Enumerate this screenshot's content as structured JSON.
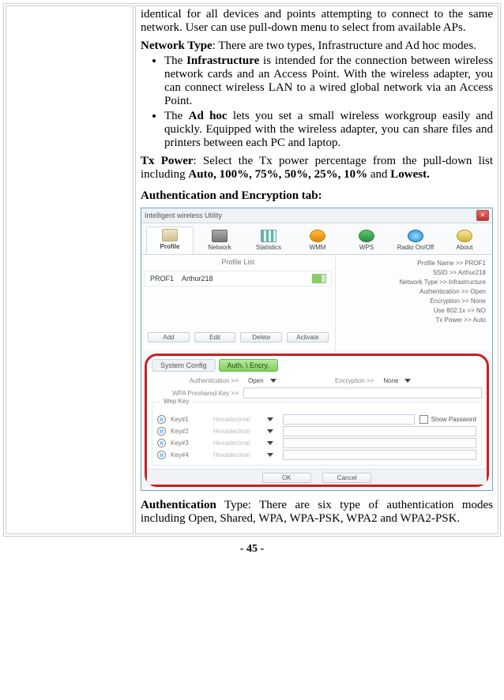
{
  "doc": {
    "intro_para": "identical for all devices and points attempting to connect to the same network. User can use pull-down menu to select from available APs.",
    "network_type_lead": "Network Type",
    "network_type_rest": ": There are two types, Infrastructure and Ad hoc modes.",
    "bullet_infra_pre": "The ",
    "bullet_infra_bold": "Infrastructure",
    "bullet_infra_post": " is intended for the connection between wireless network cards and an Access Point. With the wireless adapter, you can connect wireless LAN to a wired global network via an Access Point.",
    "bullet_adhoc_pre": "The ",
    "bullet_adhoc_bold": "Ad hoc",
    "bullet_adhoc_post": " lets you set a small wireless workgroup easily and quickly. Equipped with the wireless adapter, you can share files and printers between each PC and laptop.",
    "tx_power_lead": "Tx Power",
    "tx_power_mid": ": Select the Tx power percentage from the pull-down list including ",
    "tx_power_opts": "Auto, 100%, 75%, 50%, 25%, 10%",
    "tx_power_and": " and ",
    "tx_power_last": "Lowest.",
    "auth_heading": "Authentication and Encryption tab:",
    "auth_desc_lead": "Authentication",
    "auth_desc_rest": " Type: There are six type of authentication modes including Open, Shared, WPA, WPA-PSK, WPA2 and WPA2-PSK.",
    "page_number": "- 45 -"
  },
  "fig": {
    "window_title": "Intelligent wireless Utility",
    "tabs": {
      "profile": "Profile",
      "network": "Network",
      "statistics": "Statistics",
      "wmm": "WMM",
      "wps": "WPS",
      "radio": "Radio On/Off",
      "about": "About"
    },
    "profile_list_label": "Profile List",
    "profile_row": {
      "name": "PROF1",
      "ssid": "Arthur218"
    },
    "buttons": {
      "add": "Add",
      "edit": "Edit",
      "del": "Delete",
      "activate": "Activate"
    },
    "info": {
      "l1": "Profile Name >> PROF1",
      "l2": "SSID >> Arthur218",
      "l3": "Network Type >> Infrastructure",
      "l4": "Authentication >> Open",
      "l5": "Encryption >> None",
      "l6": "Use 802.1x >> NO",
      "l7": "Tx Power >> Auto"
    },
    "subtabs": {
      "sys": "System Config",
      "auth": "Auth. \\ Encry."
    },
    "auth_panel": {
      "auth_label": "Authentication >>",
      "auth_value": "Open",
      "enc_label": "Encryption >>",
      "enc_value": "None",
      "psk_label": "WPA Preshared Key >>",
      "wep_title": "Wep Key",
      "keys": [
        {
          "name": "Key#1",
          "fmt": "Hexadecimal"
        },
        {
          "name": "Key#2",
          "fmt": "Hexadecimal"
        },
        {
          "name": "Key#3",
          "fmt": "Hexadecimal"
        },
        {
          "name": "Key#4",
          "fmt": "Hexadecimal"
        }
      ],
      "show_password": "Show Password",
      "ok": "OK",
      "cancel": "Cancel"
    }
  }
}
